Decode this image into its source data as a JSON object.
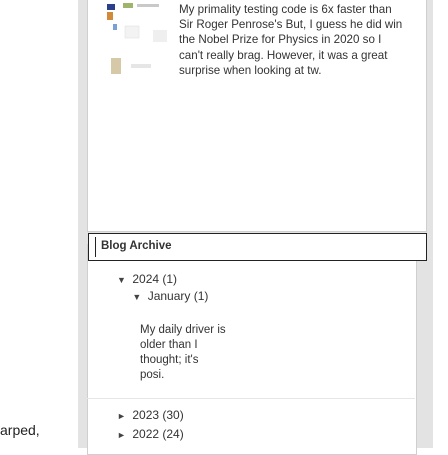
{
  "left_cut_text": "arped,",
  "intro": {
    "text": "My primality testing code is 6x faster than Sir Roger Penrose's But, I guess he did win the Nobel Prize for Physics in 2020 so I can't really brag. However, it was a great surprise when looking at tw."
  },
  "archive": {
    "title": "Blog Archive",
    "years": [
      {
        "label": "2024 (1)",
        "expanded": true
      },
      {
        "label": "2023 (30)",
        "expanded": false
      },
      {
        "label": "2022 (24)",
        "expanded": false
      }
    ],
    "month": {
      "label": "January (1)",
      "expanded": true
    },
    "post_lines": [
      "My daily driver is",
      "older than I",
      "thought; it's",
      "posi."
    ]
  },
  "icons": {
    "expanded": "▼",
    "collapsed": "►"
  },
  "colors": {
    "panel_bg": "#e3e3e3",
    "card_bg": "#ffffff",
    "text": "#333333"
  }
}
